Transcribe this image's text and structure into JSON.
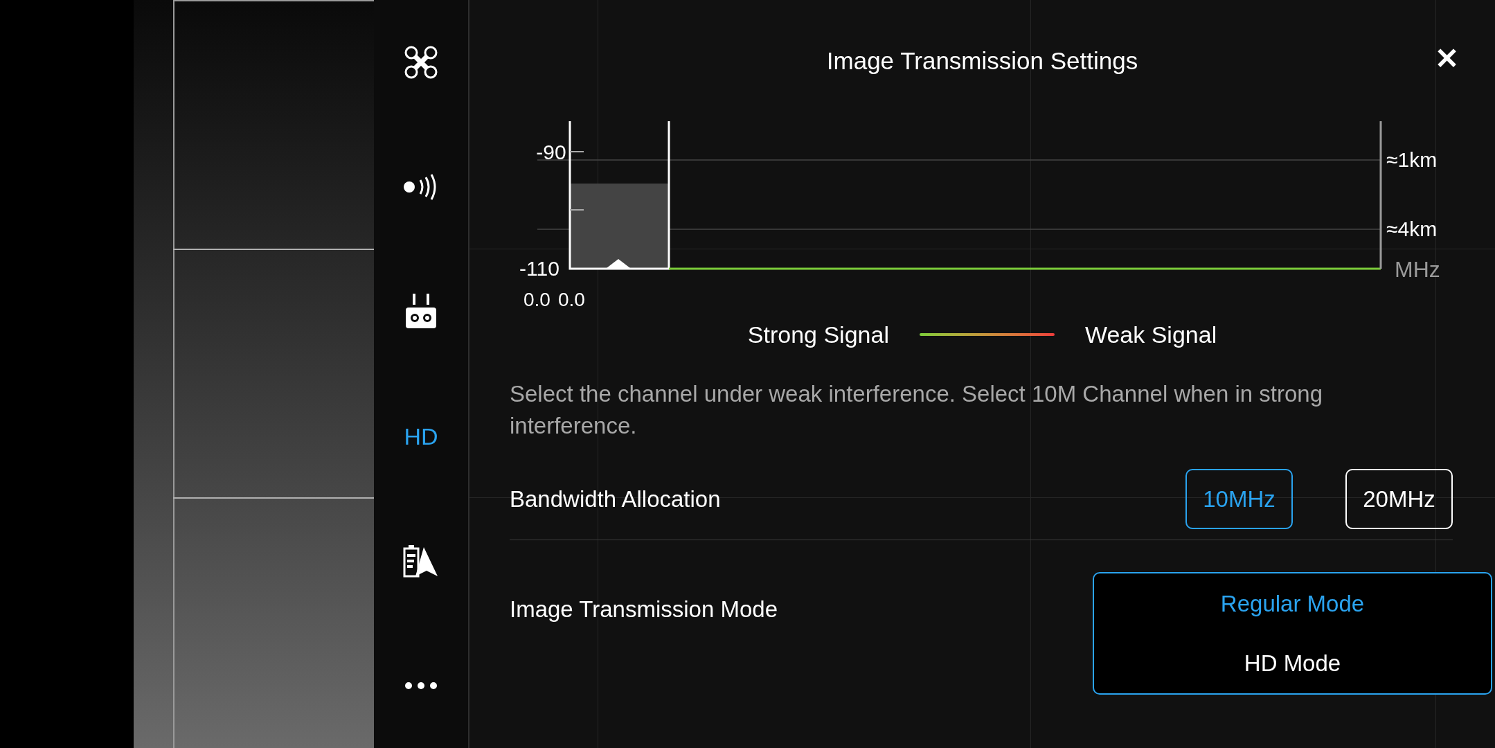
{
  "sidebar": {
    "items": [
      {
        "kind": "drone",
        "selected": false
      },
      {
        "kind": "signal",
        "selected": false
      },
      {
        "kind": "remote",
        "selected": false
      },
      {
        "kind": "text",
        "label": "HD",
        "selected": true
      },
      {
        "kind": "battery",
        "selected": false
      },
      {
        "kind": "more",
        "selected": false
      }
    ]
  },
  "panel": {
    "title": "Image Transmission Settings",
    "close": "✕"
  },
  "spectrum": {
    "y_labels": [
      "-90",
      "-110"
    ],
    "range_labels": [
      "≈1km",
      "≈4km"
    ],
    "unit": "MHz",
    "x_labels": [
      "0.0",
      "0.0"
    ]
  },
  "legend": {
    "strong": "Strong Signal",
    "weak": "Weak Signal"
  },
  "description": "Select the channel under weak interference. Select 10M Channel when in strong interference.",
  "bandwidth": {
    "label": "Bandwidth Allocation",
    "options": [
      {
        "label": "10MHz",
        "selected": true
      },
      {
        "label": "20MHz",
        "selected": false
      }
    ]
  },
  "mode": {
    "label": "Image Transmission Mode",
    "options": [
      {
        "label": "Regular Mode",
        "selected": true
      },
      {
        "label": "HD Mode",
        "selected": false
      }
    ]
  }
}
